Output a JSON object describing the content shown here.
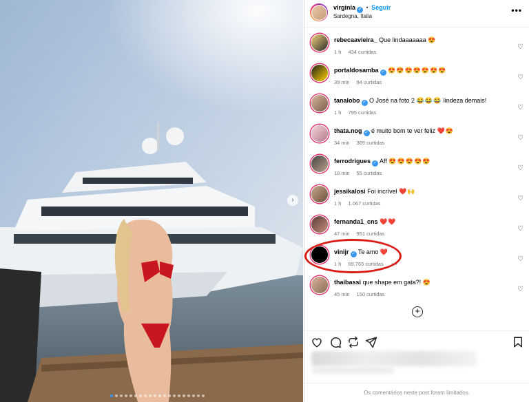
{
  "post": {
    "username": "virginia",
    "follow_label": "Seguir",
    "separator": "•",
    "location": "Sardegna, Italia",
    "more": "•••"
  },
  "comments": [
    {
      "user": "rebecaavieira_",
      "text": "Que lindaaaaaaa",
      "emoji": "😍",
      "time": "1 h",
      "likes": "434 curtidas",
      "verified": false
    },
    {
      "user": "portaldosamba",
      "text": "",
      "emoji": "😍😍😍😍😍😍😍",
      "time": "39 min",
      "likes": "94 curtidas",
      "verified": true
    },
    {
      "user": "tanalobo",
      "text": "O José na foto 2",
      "emoji": "😂😂😂",
      "text2": "lindeza demais!",
      "time": "1 h",
      "likes": "795 curtidas",
      "verified": true
    },
    {
      "user": "thata.nog",
      "text": "é muito bom te ver feliz",
      "emoji": "❤️😍",
      "time": "34 min",
      "likes": "369 curtidas",
      "verified": true
    },
    {
      "user": "ferrodrigues",
      "text": "Aff",
      "emoji": "😍😍😍😍😍",
      "time": "18 min",
      "likes": "55 curtidas",
      "verified": true
    },
    {
      "user": "jessikalosi",
      "text": "Foi incrível",
      "emoji": "❤️🙌",
      "time": "1 h",
      "likes": "1.067 curtidas",
      "verified": false
    },
    {
      "user": "fernanda1_cns",
      "text": "",
      "emoji": "❤️❤️",
      "time": "47 min",
      "likes": "951 curtidas",
      "verified": false
    },
    {
      "user": "vinijr",
      "text": "Te amo",
      "emoji": "❤️",
      "time": "1 h",
      "likes": "69.765 curtidas",
      "verified": true,
      "extra": "•••"
    },
    {
      "user": "thaibassi",
      "text": "que shape em gata?!",
      "emoji": "😍",
      "time": "45 min",
      "likes": "150 curtidas",
      "verified": false
    }
  ],
  "add_comment_icon": "plus-circle-icon",
  "actions": [
    "heart-icon",
    "comment-icon",
    "share-icon",
    "send-icon",
    "bookmark-icon"
  ],
  "footer": "Os comentários neste post foram limitados.",
  "colors": {
    "accent": "#0095f6",
    "highlight": "#d91e18",
    "verified": "#3897f0"
  }
}
